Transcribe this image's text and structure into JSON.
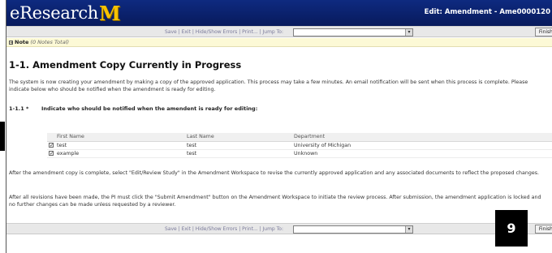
{
  "header": {
    "logo_text": "eResearch",
    "logo_mark": "M",
    "title": "Edit: Amendment - Ame0000120"
  },
  "toolbar": {
    "links": "Save | Exit | Hide/Show Errors | Print... | Jump To:",
    "jump_value": "",
    "finish_label": "Finish"
  },
  "note": {
    "expand_glyph": "+",
    "label": "Note",
    "count": "(0 Notes Total)"
  },
  "page": {
    "title": "1-1. Amendment Copy Currently in Progress",
    "intro": "The system is now creating your amendment by making a copy of the approved application. This process may take a few minutes. An email notification will be sent when this process is complete. Please indicate below who should be notified when the amendment is ready for editing."
  },
  "question": {
    "number": "1-1.1 *",
    "text": "Indicate who should be notified when the amendent is ready for editing:"
  },
  "table": {
    "headers": [
      "First Name",
      "Last Name",
      "Department"
    ],
    "rows": [
      {
        "checked": true,
        "first": "test",
        "last": "test",
        "department": "University of Michigan"
      },
      {
        "checked": true,
        "first": "example",
        "last": "test",
        "department": "Unknown"
      }
    ]
  },
  "paragraphs": {
    "after_copy": "After the amendment copy is complete, select \"Edit/Review Study\" in the Amendment Workspace to revise the currently approved application and any associated documents to reflect the proposed changes.",
    "after_revisions": "After all revisions have been made, the PI must click the \"Submit Amendment\" button on the Amendment Workspace to initiate the review process. After submission, the amendment application is locked and no further changes can be made unless requested by a reviewer."
  },
  "step_badge": "9",
  "colors": {
    "header_bg": "#0b1f6b",
    "logo_mark": "#f6c200",
    "note_bg": "#fcf9d6",
    "toolbar_bg": "#e8e8e8"
  }
}
